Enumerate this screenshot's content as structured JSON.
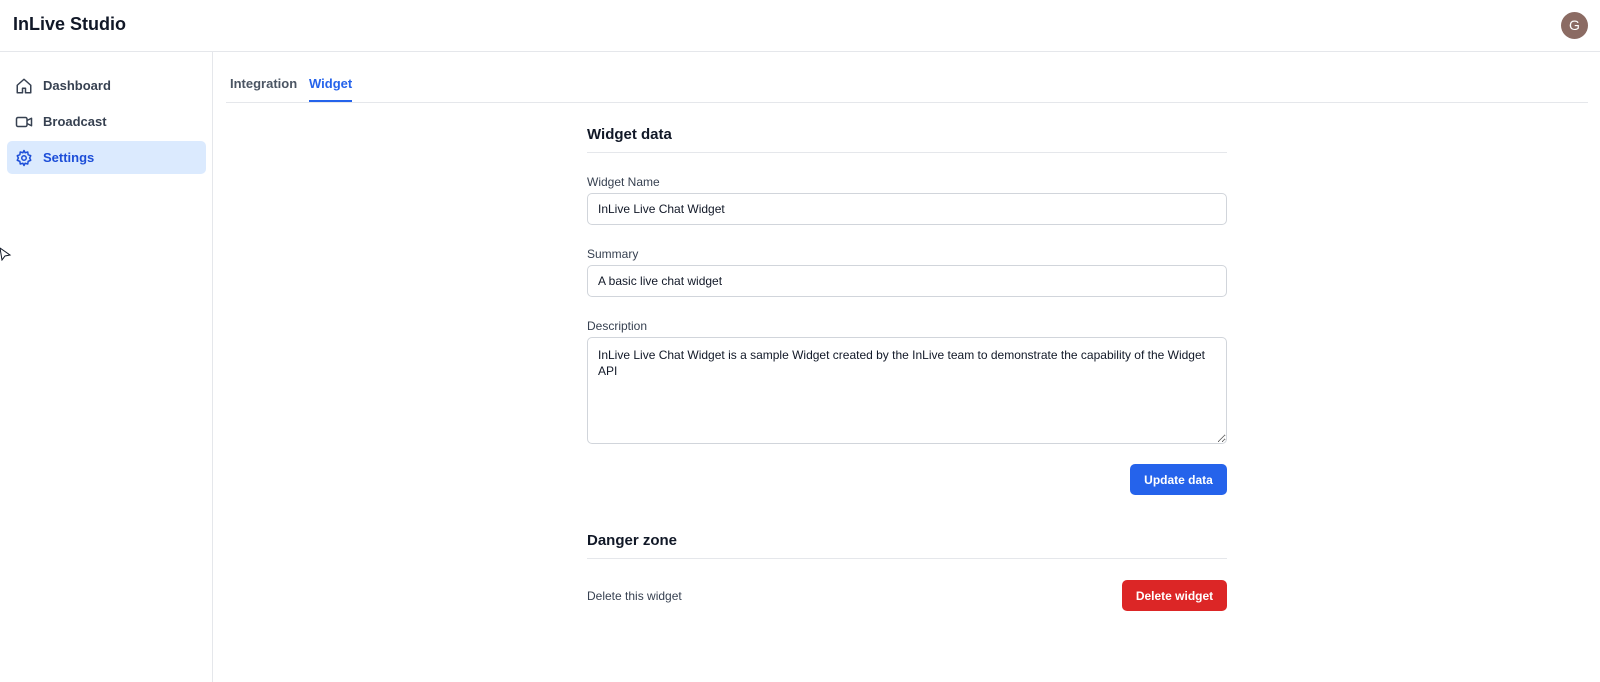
{
  "app": {
    "title": "InLive Studio",
    "avatar_initial": "G"
  },
  "sidebar": {
    "items": [
      {
        "label": "Dashboard",
        "icon": "home-icon"
      },
      {
        "label": "Broadcast",
        "icon": "video-icon"
      },
      {
        "label": "Settings",
        "icon": "gear-icon",
        "active": true
      }
    ]
  },
  "tabs": [
    {
      "label": "Integration"
    },
    {
      "label": "Widget",
      "active": true
    }
  ],
  "widget_data": {
    "section_title": "Widget data",
    "name_label": "Widget Name",
    "name_value": "InLive Live Chat Widget",
    "summary_label": "Summary",
    "summary_value": "A basic live chat widget",
    "description_label": "Description",
    "description_value": "InLive Live Chat Widget is a sample Widget created by the InLive team to demonstrate the capability of the Widget API",
    "update_button": "Update data"
  },
  "danger_zone": {
    "section_title": "Danger zone",
    "text": "Delete this widget",
    "delete_button": "Delete widget"
  },
  "colors": {
    "primary": "#2563eb",
    "danger": "#dc2626",
    "active_bg": "#dbeafe",
    "avatar": "#8b6b63"
  }
}
